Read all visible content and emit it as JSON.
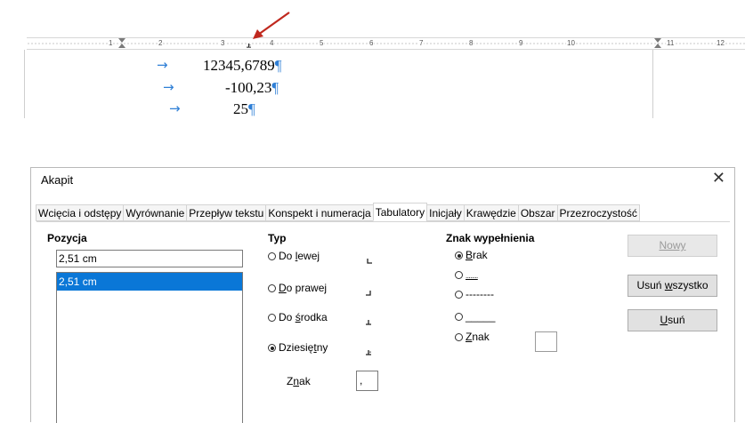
{
  "ruler": {
    "numbers": [
      "1",
      "2",
      "3",
      "4",
      "5",
      "6",
      "7",
      "8",
      "9",
      "10",
      "11",
      "12"
    ]
  },
  "document": {
    "lines": [
      {
        "text": "12345,6789",
        "mark": "¶"
      },
      {
        "text": "-100,23",
        "mark": "¶"
      },
      {
        "text": "25",
        "mark": "¶"
      }
    ],
    "tab_arrow": "→"
  },
  "dialog": {
    "title": "Akapit",
    "close": "✕",
    "tabs": [
      "Wcięcia i odstępy",
      "Wyrównanie",
      "Przepływ tekstu",
      "Konspekt i numeracja",
      "Tabulatory",
      "Inicjały",
      "Krawędzie",
      "Obszar",
      "Przezroczystość"
    ],
    "active_tab": "Tabulatory",
    "position": {
      "label": "Pozycja",
      "input_value": "2,51 cm",
      "list_items": [
        "2,51 cm"
      ]
    },
    "type": {
      "label": "Typ",
      "options": [
        {
          "pre": "Do ",
          "key": "l",
          "post": "ewej",
          "checked": false,
          "glyph": "left-tab-icon"
        },
        {
          "pre": "",
          "key": "D",
          "post": "o prawej",
          "checked": false,
          "glyph": "right-tab-icon"
        },
        {
          "pre": "Do ",
          "key": "ś",
          "post": "rodka",
          "checked": false,
          "glyph": "center-tab-icon"
        },
        {
          "pre": "Dziesię",
          "key": "t",
          "post": "ny",
          "checked": true,
          "glyph": "decimal-tab-icon"
        }
      ],
      "char_label_pre": "Z",
      "char_label_key": "n",
      "char_label_post": "ak",
      "char_value": ","
    },
    "fill": {
      "label": "Znak wypełnienia",
      "options": [
        {
          "pre": "",
          "key": "B",
          "post": "rak",
          "checked": true
        },
        {
          "pre": "",
          "key": "",
          "post": "........",
          "checked": false
        },
        {
          "pre": "",
          "key": "",
          "post": "--------",
          "checked": false
        },
        {
          "pre": "",
          "key": "",
          "post": "_____",
          "checked": false
        },
        {
          "pre": "",
          "key": "Z",
          "post": "nak",
          "checked": false
        }
      ]
    },
    "buttons": {
      "new": "Nowy",
      "delete_all_pre": "Usuń ",
      "delete_all_key": "w",
      "delete_all_post": "szystko",
      "delete_pre": "",
      "delete_key": "U",
      "delete_post": "suń"
    }
  },
  "colors": {
    "accent": "#0a77d7",
    "formatting_marks": "#2f7fd6",
    "annotation_arrow": "#c0281e"
  }
}
